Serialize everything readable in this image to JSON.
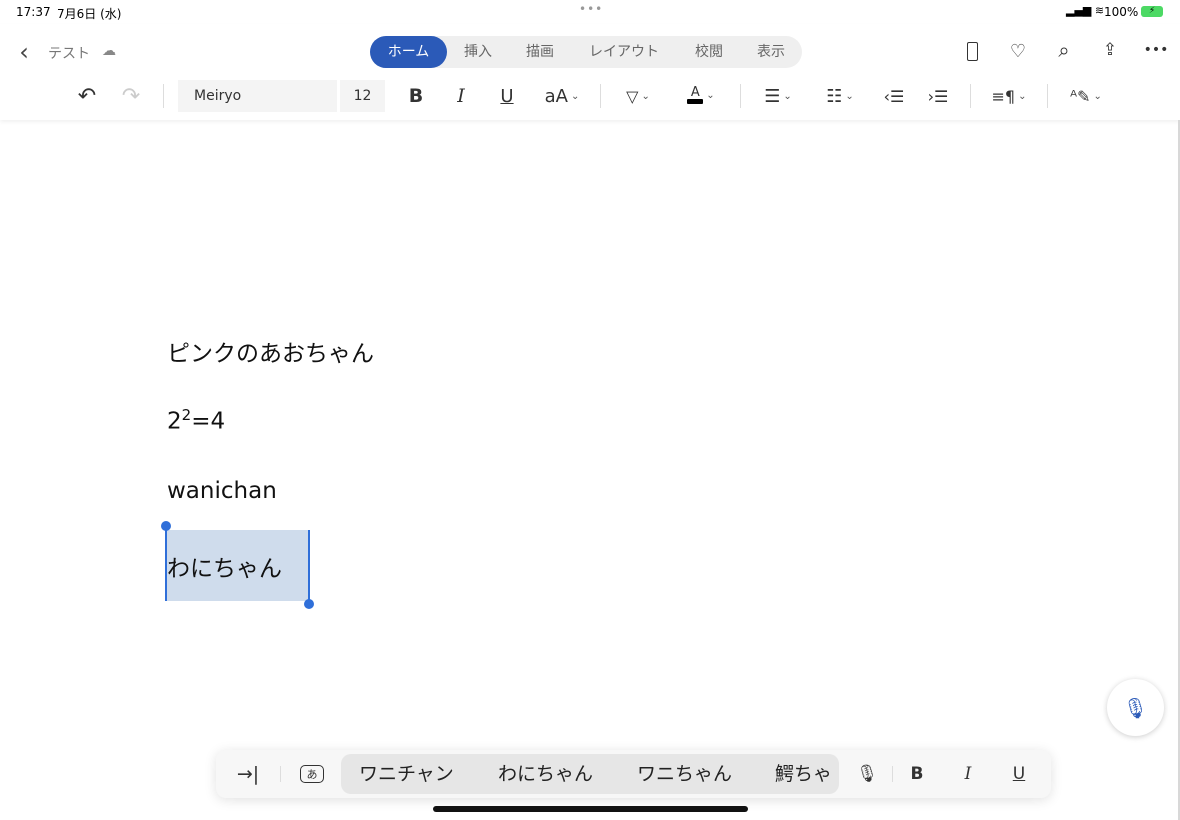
{
  "status_bar": {
    "time": "17:37",
    "date": "7月6日 (水)",
    "battery": "100%",
    "accent": "#4cd964"
  },
  "header": {
    "doc_title": "テスト",
    "tabs": [
      {
        "label": "ホーム",
        "active": true
      },
      {
        "label": "挿入"
      },
      {
        "label": "描画"
      },
      {
        "label": "レイアウト"
      },
      {
        "label": "校閲"
      },
      {
        "label": "表示"
      }
    ],
    "accent": "#2b5ab8"
  },
  "toolbar": {
    "font_name": "Meiryo",
    "font_size": "12",
    "bold": "B",
    "italic": "I",
    "underline": "U",
    "text_size": "aA"
  },
  "document": {
    "lines": [
      "ピンクのあおちゃん",
      "2",
      "2",
      "=4",
      "wanichan",
      "わにちゃん"
    ],
    "selection_color": "#cfdcec",
    "handle_color": "#2f6fd9"
  },
  "keyboard_bar": {
    "candidates": [
      "ワニチャン",
      "わにちゃん",
      "ワニちゃん",
      "鰐ちゃ"
    ],
    "kana_key": "あ",
    "bold": "B",
    "italic": "I",
    "underline": "U"
  }
}
